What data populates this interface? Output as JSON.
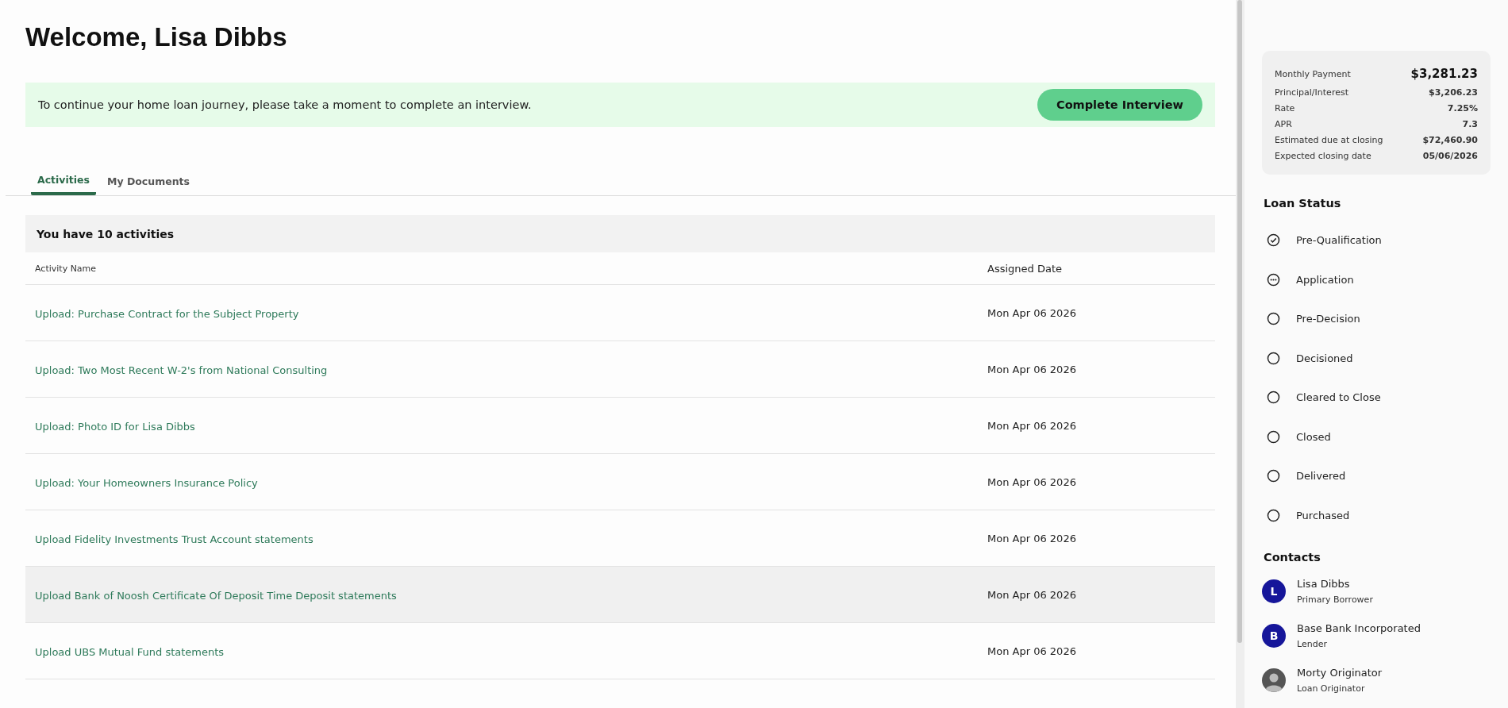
{
  "welcome": {
    "title": "Welcome, Lisa Dibbs"
  },
  "banner": {
    "message": "To continue your home loan journey, please take a moment to complete an interview.",
    "button": "Complete Interview"
  },
  "tabs": [
    {
      "label": "Activities",
      "selected": true
    },
    {
      "label": "My Documents",
      "selected": false
    }
  ],
  "activities": {
    "summary": "You have 10 activities",
    "columns": [
      "Activity Name",
      "Assigned Date"
    ],
    "rows": [
      {
        "name": "Upload: Purchase Contract for the Subject Property",
        "date": "Mon Apr 06 2026",
        "hovered": false
      },
      {
        "name": "Upload: Two Most Recent W-2's from National Consulting",
        "date": "Mon Apr 06 2026",
        "hovered": false
      },
      {
        "name": "Upload: Photo ID for Lisa Dibbs",
        "date": "Mon Apr 06 2026",
        "hovered": false
      },
      {
        "name": "Upload: Your Homeowners Insurance Policy",
        "date": "Mon Apr 06 2026",
        "hovered": false
      },
      {
        "name": "Upload Fidelity Investments Trust Account statements",
        "date": "Mon Apr 06 2026",
        "hovered": false
      },
      {
        "name": "Upload Bank of Noosh Certificate Of Deposit Time Deposit statements",
        "date": "Mon Apr 06 2026",
        "hovered": true
      },
      {
        "name": "Upload UBS Mutual Fund statements",
        "date": "Mon Apr 06 2026",
        "hovered": false
      }
    ]
  },
  "loan_overview": {
    "items": [
      {
        "label": "Monthly Payment",
        "value": "$3,281.23",
        "kind": "primary"
      },
      {
        "label": "Principal/Interest",
        "value": "$3,206.23",
        "kind": "detail"
      },
      {
        "label": "Rate",
        "value": "7.25%",
        "kind": "detail"
      },
      {
        "label": "APR",
        "value": "7.3",
        "kind": "detail"
      },
      {
        "label": "Estimated due at closing",
        "value": "$72,460.90",
        "kind": "detail"
      },
      {
        "label": "Expected closing date",
        "value": "05/06/2026",
        "kind": "detail"
      }
    ]
  },
  "loan_status": {
    "title": "Loan Status",
    "steps": [
      {
        "label": "Pre-Qualification",
        "kind": "complete"
      },
      {
        "label": "Application",
        "kind": "in_progress"
      },
      {
        "label": "Pre-Decision",
        "kind": "pending"
      },
      {
        "label": "Decisioned",
        "kind": "pending"
      },
      {
        "label": "Cleared to Close",
        "kind": "pending"
      },
      {
        "label": "Closed",
        "kind": "pending"
      },
      {
        "label": "Delivered",
        "kind": "pending"
      },
      {
        "label": "Purchased",
        "kind": "pending"
      }
    ]
  },
  "contacts": {
    "title": "Contacts",
    "people": [
      {
        "name": "Lisa Dibbs",
        "role": "Primary Borrower",
        "avatar": {
          "kind": "initial",
          "text": "L"
        }
      },
      {
        "name": "Base Bank Incorporated",
        "role": "Lender",
        "avatar": {
          "kind": "initial",
          "text": "B"
        }
      },
      {
        "name": "Morty Originator",
        "role": "Loan Originator",
        "avatar": {
          "kind": "photo"
        }
      }
    ]
  }
}
